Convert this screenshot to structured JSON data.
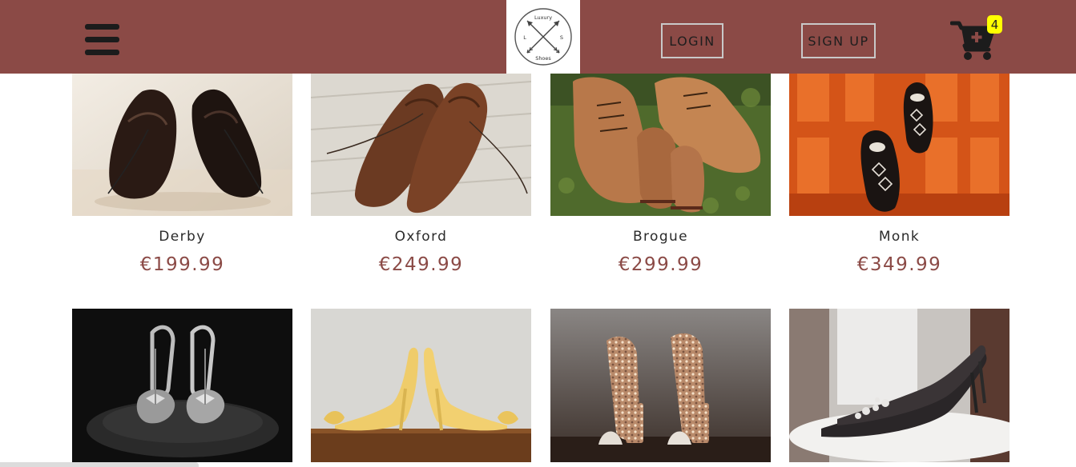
{
  "brand": {
    "logo_top": "Luxury",
    "logo_bottom": "Shoes",
    "logo_left": "L",
    "logo_right": "S"
  },
  "header": {
    "background": "#8b4a46",
    "menu_icon": "hamburger-icon",
    "login_label": "LOGIN",
    "signup_label": "SIGN UP",
    "cart_icon": "cart-plus-icon",
    "cart_count": "4",
    "badge_color": "#ffff00"
  },
  "products": [
    {
      "name": "Derby",
      "price": "€199.99",
      "image": "black leather derby shoes"
    },
    {
      "name": "Oxford",
      "price": "€249.99",
      "image": "brown leather oxford shoes"
    },
    {
      "name": "Brogue",
      "price": "€299.99",
      "image": "tan suede hiking boots on grass"
    },
    {
      "name": "Monk",
      "price": "€349.99",
      "image": "patterned slip-on shoes on orange"
    },
    {
      "name": "",
      "price": "",
      "image": "silver bow sandals on black"
    },
    {
      "name": "",
      "price": "",
      "image": "yellow satin stiletto heels"
    },
    {
      "name": "",
      "price": "",
      "image": "glitter block heel sandals"
    },
    {
      "name": "",
      "price": "",
      "image": "black sequin pumps with brooch"
    }
  ],
  "accent_color": "#8b4a46"
}
